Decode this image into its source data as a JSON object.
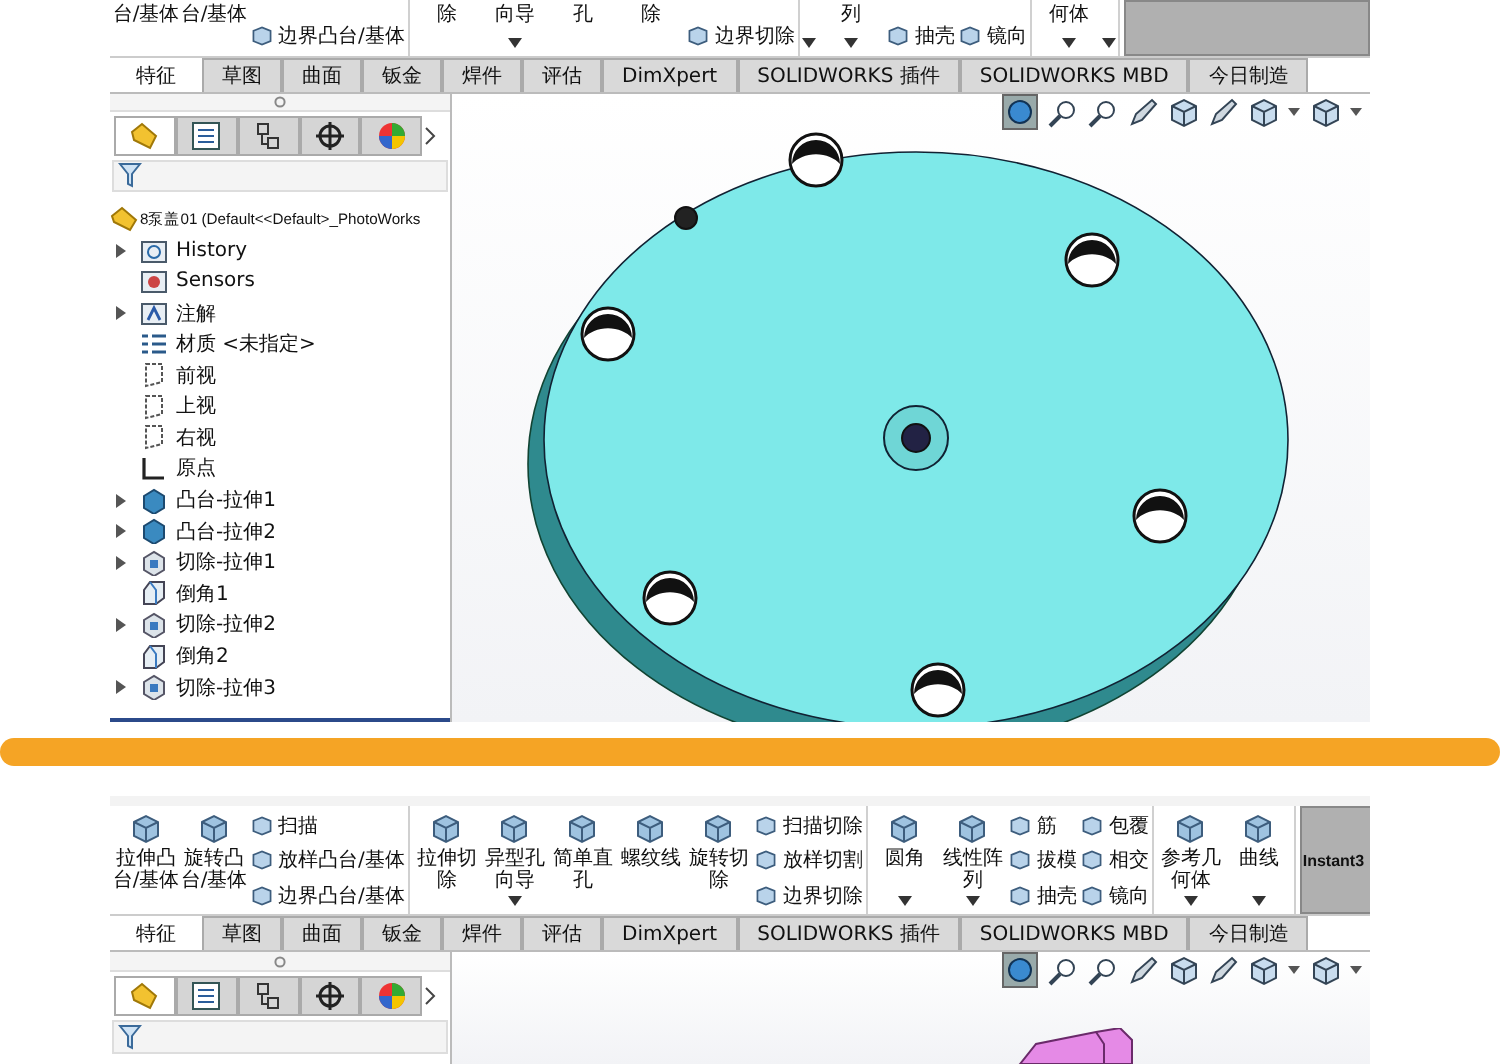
{
  "panels": [
    {
      "toolbar_cropped": true,
      "toolbar": [
        [
          {
            "kind": "big",
            "label": "台/基体",
            "dropdown": false
          },
          {
            "kind": "big",
            "label": "台/基体",
            "dropdown": false
          },
          {
            "kind": "stack",
            "items": [
              "边界凸台/基体"
            ]
          }
        ],
        [
          {
            "kind": "big",
            "label": "除",
            "dropdown": false
          },
          {
            "kind": "big",
            "label": "向导",
            "dropdown": true
          },
          {
            "kind": "big",
            "label": "孔",
            "dropdown": false
          },
          {
            "kind": "big",
            "label": "除",
            "dropdown": false
          },
          {
            "kind": "stack",
            "items": [
              "边界切除"
            ]
          }
        ],
        [
          {
            "kind": "big",
            "dropdown": true
          },
          {
            "kind": "big",
            "label": "列",
            "dropdown": true
          },
          {
            "kind": "stack",
            "items": [
              "抽壳"
            ]
          },
          {
            "kind": "stack",
            "items": [
              "镜向"
            ]
          }
        ],
        [
          {
            "kind": "big",
            "label": "何体",
            "dropdown": true
          },
          {
            "kind": "big",
            "dropdown": true
          }
        ]
      ],
      "tabs": [
        {
          "label": "特征",
          "selected": true
        },
        {
          "label": "草图",
          "selected": false
        },
        {
          "label": "曲面",
          "selected": false
        },
        {
          "label": "钣金",
          "selected": false
        },
        {
          "label": "焊件",
          "selected": false
        },
        {
          "label": "评估",
          "selected": false
        },
        {
          "label": "DimXpert",
          "selected": false
        },
        {
          "label": "SOLIDWORKS 插件",
          "selected": false
        },
        {
          "label": "SOLIDWORKS MBD",
          "selected": false
        },
        {
          "label": "今日制造",
          "selected": false
        }
      ],
      "pane_tabs": [
        {
          "selected": true
        },
        {
          "selected": false
        },
        {
          "selected": false
        },
        {
          "selected": false
        },
        {
          "selected": false
        }
      ],
      "tree": {
        "root": "8泵盖01 (Default<<Default>_PhotoWorks",
        "items": [
          {
            "label": "History",
            "kind": "history",
            "expandable": true
          },
          {
            "label": "Sensors",
            "kind": "sensors",
            "expandable": false
          },
          {
            "label": "注解",
            "kind": "annotation",
            "expandable": true
          },
          {
            "label": "材质 <未指定>",
            "kind": "material",
            "expandable": false
          },
          {
            "label": "前视",
            "kind": "plane",
            "expandable": false
          },
          {
            "label": "上视",
            "kind": "plane",
            "expandable": false
          },
          {
            "label": "右视",
            "kind": "plane",
            "expandable": false
          },
          {
            "label": "原点",
            "kind": "origin",
            "expandable": false
          },
          {
            "label": "凸台-拉伸1",
            "kind": "boss",
            "expandable": true
          },
          {
            "label": "凸台-拉伸2",
            "kind": "boss",
            "expandable": true
          },
          {
            "label": "切除-拉伸1",
            "kind": "cut",
            "expandable": true
          },
          {
            "label": "倒角1",
            "kind": "chamfer",
            "expandable": false
          },
          {
            "label": "切除-拉伸2",
            "kind": "cut",
            "expandable": true
          },
          {
            "label": "倒角2",
            "kind": "chamfer",
            "expandable": false
          },
          {
            "label": "切除-拉伸3",
            "kind": "cut",
            "expandable": true
          }
        ]
      },
      "viewport": {
        "kind": "pump_cover"
      }
    },
    {
      "toolbar_cropped": false,
      "toolbar": [
        [
          {
            "kind": "big",
            "label": "拉伸凸台/基体",
            "dropdown": false
          },
          {
            "kind": "big",
            "label": "旋转凸台/基体",
            "dropdown": false
          },
          {
            "kind": "stack",
            "items": [
              "扫描",
              "放样凸台/基体",
              "边界凸台/基体"
            ]
          }
        ],
        [
          {
            "kind": "big",
            "label": "拉伸切除",
            "dropdown": false
          },
          {
            "kind": "big",
            "label": "异型孔向导",
            "dropdown": true
          },
          {
            "kind": "big",
            "label": "简单直孔",
            "dropdown": false
          },
          {
            "kind": "big",
            "label": "螺纹线",
            "dropdown": false
          },
          {
            "kind": "big",
            "label": "旋转切除",
            "dropdown": false
          },
          {
            "kind": "stack",
            "items": [
              "扫描切除",
              "放样切割",
              "边界切除"
            ]
          }
        ],
        [
          {
            "kind": "big",
            "label": "圆角",
            "dropdown": true
          },
          {
            "kind": "big",
            "label": "线性阵列",
            "dropdown": true
          },
          {
            "kind": "stack",
            "items": [
              "筋",
              "拔模",
              "抽壳"
            ]
          },
          {
            "kind": "stack",
            "items": [
              "包覆",
              "相交",
              "镜向"
            ]
          }
        ],
        [
          {
            "kind": "big",
            "label": "参考几何体",
            "dropdown": true
          },
          {
            "kind": "big",
            "label": "曲线",
            "dropdown": true
          }
        ]
      ],
      "instant_label": "Instant3",
      "pane_tabs": [
        {
          "selected": true
        },
        {
          "selected": false
        },
        {
          "selected": false
        },
        {
          "selected": false
        },
        {
          "selected": false
        }
      ],
      "tabs": [
        {
          "label": "特征",
          "selected": true
        },
        {
          "label": "草图",
          "selected": false
        },
        {
          "label": "曲面",
          "selected": false
        },
        {
          "label": "钣金",
          "selected": false
        },
        {
          "label": "焊件",
          "selected": false
        },
        {
          "label": "评估",
          "selected": false
        },
        {
          "label": "DimXpert",
          "selected": false
        },
        {
          "label": "SOLIDWORKS 插件",
          "selected": false
        },
        {
          "label": "SOLIDWORKS MBD",
          "selected": false
        },
        {
          "label": "今日制造",
          "selected": false
        }
      ],
      "viewport": {
        "kind": "part"
      }
    }
  ]
}
